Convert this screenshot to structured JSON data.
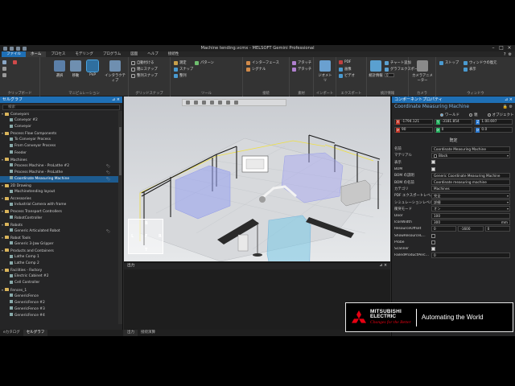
{
  "window": {
    "title": "Machine tending.vcmx - MELSOFT Gemini Professional"
  },
  "tabs": [
    "ファイル",
    "ホーム",
    "プロセス",
    "モデリング",
    "プログラム",
    "図面",
    "ヘルプ",
    "接続性"
  ],
  "ribbon": {
    "groups": {
      "clipboard": "クリップボード",
      "manipulation": "マニピュレーション",
      "grid_snap": "グリッドスナップ",
      "tools": "ツール",
      "connect": "接続",
      "material": "素材",
      "import": "インポート",
      "export": "エクスポート",
      "statistics": "統計情報",
      "camera": "カメラ",
      "window": "ウィンドウ"
    },
    "buttons": {
      "select": "選択",
      "move": "移動",
      "pnp": "PnP",
      "interactive": "インタラクティブ",
      "snap_all": "自動付ける",
      "snap_parent": "親にスナップ",
      "snap_align": "整列スナップ",
      "measure": "測定",
      "snap": "スナップ",
      "align": "整列",
      "pattern": "パターン",
      "interface": "インターフェース",
      "signal": "シグナル",
      "attach": "アタッチ",
      "detach": "デタッチ",
      "geometry": "ジオメトリ",
      "pdf": "PDF",
      "image": "画像",
      "video": "ビデオ",
      "statistics_btn": "統計情報",
      "chart": "チャート追加",
      "graph": "グラフエクスポート",
      "camera_animator": "カメラアニメーター",
      "stop": "ストップ",
      "window_reset": "ウィンドウの復元",
      "display": "表示"
    },
    "zoom_value": "0"
  },
  "left_panel": {
    "title": "セルグラフ",
    "search_placeholder": "検索",
    "items": [
      {
        "label": "Conveyors",
        "type": "folder",
        "level": 0
      },
      {
        "label": "Conveyor #2",
        "type": "item",
        "level": 1
      },
      {
        "label": "Conveyor",
        "type": "item",
        "level": 1
      },
      {
        "label": "Process Flow Components",
        "type": "folder",
        "level": 0
      },
      {
        "label": "To Conveyor Process",
        "type": "item",
        "level": 1
      },
      {
        "label": "From Conveyor Process",
        "type": "item",
        "level": 1
      },
      {
        "label": "Feeder",
        "type": "item",
        "level": 1
      },
      {
        "label": "Machines",
        "type": "folder",
        "level": 0
      },
      {
        "label": "Process Machine - ProLathe #2",
        "type": "item",
        "level": 1,
        "right": "🏷"
      },
      {
        "label": "Process Machine - ProLathe",
        "type": "item",
        "level": 1,
        "right": "🏷"
      },
      {
        "label": "Coordinate Measuring Machine",
        "type": "item",
        "level": 1,
        "right": "🏷",
        "selected": true
      },
      {
        "label": "2D Drawing",
        "type": "folder",
        "level": 0
      },
      {
        "label": "Machinetending layout",
        "type": "item",
        "level": 1
      },
      {
        "label": "Accessories",
        "type": "folder",
        "level": 0
      },
      {
        "label": "Industrial Camera with frame",
        "type": "item",
        "level": 1
      },
      {
        "label": "Process Transport Controllers",
        "type": "folder",
        "level": 0
      },
      {
        "label": "RobotController",
        "type": "item",
        "level": 1
      },
      {
        "label": "Robots",
        "type": "folder",
        "level": 0
      },
      {
        "label": "Generic Articulated Robot",
        "type": "item",
        "level": 1,
        "right": "🏷"
      },
      {
        "label": "Robot Tools",
        "type": "folder",
        "level": 0
      },
      {
        "label": "Generic 3-Jaw Gripper",
        "type": "item",
        "level": 1
      },
      {
        "label": "Products and Containers",
        "type": "folder",
        "level": 0
      },
      {
        "label": "Lathe Comp 1",
        "type": "item",
        "level": 1
      },
      {
        "label": "Lathe Comp 2",
        "type": "item",
        "level": 1
      },
      {
        "label": "Facilities - Factory",
        "type": "folder",
        "level": 0
      },
      {
        "label": "Electric Cabinet #2",
        "type": "item",
        "level": 1
      },
      {
        "label": "Cell Controller",
        "type": "item",
        "level": 1
      },
      {
        "label": "Fences_1",
        "type": "folder",
        "level": 0
      },
      {
        "label": "GenericFence",
        "type": "item",
        "level": 1
      },
      {
        "label": "GenericFence #2",
        "type": "item",
        "level": 1
      },
      {
        "label": "GenericFence #3",
        "type": "item",
        "level": 1
      },
      {
        "label": "GenericFence #4",
        "type": "item",
        "level": 1
      }
    ],
    "bottom_tabs": [
      "eカタログ",
      "セルグラフ"
    ]
  },
  "viewport": {
    "nav_cube": {
      "top": "B",
      "left": "L",
      "front": "F",
      "right": "R",
      "bottom": "T"
    }
  },
  "output": {
    "title": "出力",
    "tabs": [
      "出力",
      "接続演算"
    ]
  },
  "right_panel": {
    "title": "コンポーネントプロパティ",
    "component_name": "Coordinate Measuring Machine",
    "coord_modes": [
      "ワールド",
      "親",
      "オブジェクト"
    ],
    "coords": {
      "x": "-1794.121",
      "y": "-3181.854",
      "z": "0",
      "rz": "90",
      "ry": "0",
      "rx": "0.0",
      "extra": "1.00.697"
    },
    "section": "既定",
    "props": [
      {
        "name": "名前",
        "value": "Coordinate Measuring Machine",
        "kind": "text"
      },
      {
        "name": "マテリアル",
        "value": "Black",
        "kind": "dropdown",
        "swatch": "#000000"
      },
      {
        "name": "表示",
        "kind": "check",
        "checked": true
      },
      {
        "name": "BOM",
        "kind": "check",
        "checked": true
      },
      {
        "name": "BOM の説明",
        "value": "Generic Coordinate Measuring Machine",
        "kind": "text"
      },
      {
        "name": "BOM の名前",
        "value": "Coordinate measuring machine",
        "kind": "text"
      },
      {
        "name": "カテゴリ",
        "value": "Machines",
        "kind": "text"
      },
      {
        "name": "PDF エクスポートレベル",
        "value": "完全",
        "kind": "dropdown"
      },
      {
        "name": "シミュレーションレベル",
        "value": "詳細",
        "kind": "dropdown"
      },
      {
        "name": "衝突モード",
        "value": "オン",
        "kind": "dropdown"
      },
      {
        "name": "Door",
        "value": "100",
        "kind": "text"
      },
      {
        "name": "IconWidth",
        "value": "300",
        "kind": "text",
        "unit": "mm"
      },
      {
        "name": "ResourceOffset",
        "kind": "multi",
        "values": [
          "0",
          "-1600",
          "0"
        ]
      },
      {
        "name": "ShowResourceL...",
        "kind": "check",
        "checked": false
      },
      {
        "name": "Probe",
        "kind": "check",
        "checked": false
      },
      {
        "name": "Scanner",
        "kind": "check",
        "checked": true
      },
      {
        "name": "FailedProductPerc...",
        "value": "0",
        "kind": "text"
      }
    ]
  },
  "brand": {
    "company_line1": "MITSUBISHI",
    "company_line2": "ELECTRIC",
    "slogan": "Changes for the Better",
    "tagline": "Automating the World"
  }
}
